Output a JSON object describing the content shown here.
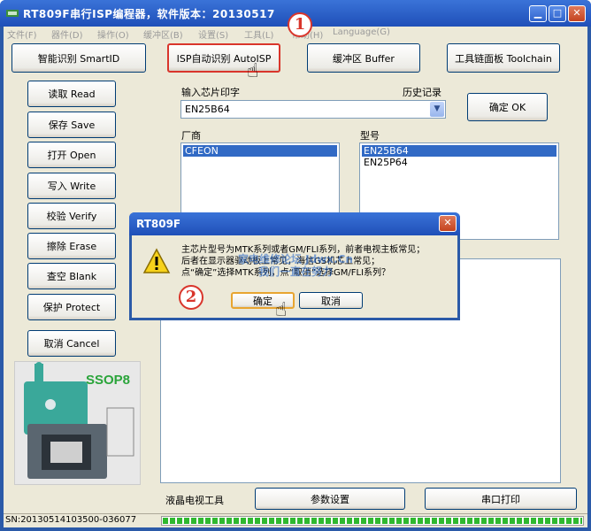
{
  "window": {
    "title": "RT809F串行ISP编程器，软件版本：20130517"
  },
  "menu": [
    "文件(F)",
    "器件(D)",
    "操作(O)",
    "缓冲区(B)",
    "设置(S)",
    "工具(L)",
    "帮助(H)",
    "Language(G)"
  ],
  "top_buttons": {
    "smartid": "智能识别 SmartID",
    "autoisp": "ISP自动识别 AutoISP",
    "buffer": "缓冲区 Buffer",
    "toolchain": "工具链面板 Toolchain"
  },
  "side_buttons": {
    "read": "读取 Read",
    "save": "保存 Save",
    "open": "打开 Open",
    "write": "写入 Write",
    "verify": "校验 Verify",
    "erase": "擦除 Erase",
    "blank": "查空 Blank",
    "protect": "保护 Protect",
    "cancel": "取消 Cancel"
  },
  "chip": {
    "input_label": "输入芯片印字",
    "history_label": "历史记录",
    "value": "EN25B64",
    "ok_button": "确定 OK"
  },
  "vendor": {
    "label": "厂商",
    "items": [
      "CFEON"
    ]
  },
  "model": {
    "label": "型号",
    "items": [
      "EN25B64",
      "EN25P64"
    ]
  },
  "package_image": {
    "label": "SSOP8"
  },
  "bottom": {
    "lcd_label": "液晶电视工具",
    "params_button": "参数设置",
    "serial_button": "串口打印"
  },
  "status_bar": {
    "serial": "SN:20130514103500-036077"
  },
  "progress": {
    "fill_fraction": 1.0
  },
  "dialog": {
    "title": "RT809F",
    "message_lines": [
      "主芯片型号为MTK系列或者GM/FLI系列，前者电视主板常见；",
      "后者在显示器驱动板上常见，海信GS机芯上常见；",
      "点“确定”选择MTK系列，点“取消”选择GM/FLI系列？"
    ],
    "watermark_lines": [
      "家电维修论坛 Jdwx.Cn",
      "我们一直在努力"
    ],
    "ok_button": "确定",
    "cancel_button": "取消"
  },
  "annotations": {
    "badge1": "1",
    "badge2": "2"
  },
  "colors": {
    "title": "#1f4fb8",
    "selection": "#316ac5",
    "badge": "#d9352b",
    "progress": "#2fb82f"
  }
}
